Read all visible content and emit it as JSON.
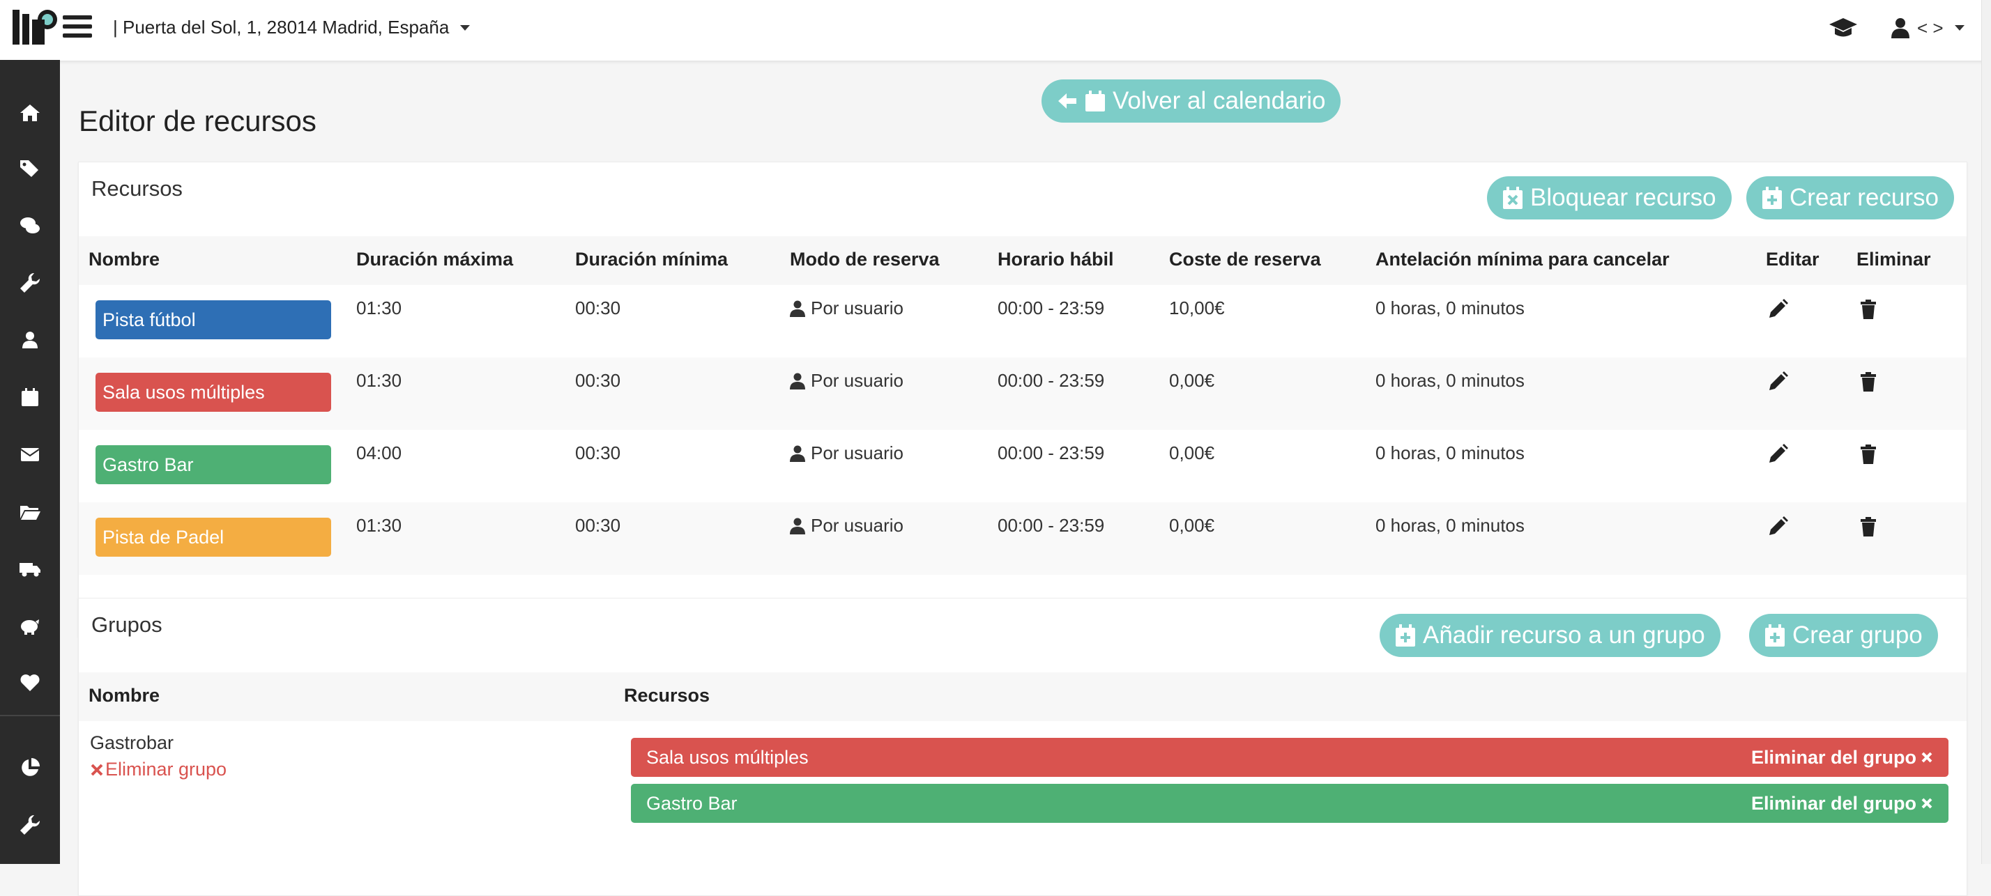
{
  "topbar": {
    "location": "| Puerta del Sol, 1, 28014 Madrid, España",
    "user_label": "< >"
  },
  "page": {
    "title": "Editor de recursos",
    "back_button": "Volver al calendario"
  },
  "resources": {
    "title": "Recursos",
    "block_button": "Bloquear recurso",
    "create_button": "Crear recurso",
    "headers": [
      "Nombre",
      "Duración máxima",
      "Duración mínima",
      "Modo de reserva",
      "Horario hábil",
      "Coste de reserva",
      "Antelación mínima para cancelar",
      "Editar",
      "Eliminar"
    ],
    "rows": [
      {
        "name": "Pista fútbol",
        "color": "#2e6fb5",
        "max": "01:30",
        "min": "00:30",
        "mode": "Por usuario",
        "hours": "00:00 - 23:59",
        "cost": "10,00€",
        "cancel": "0 horas, 0 minutos"
      },
      {
        "name": "Sala usos múltiples",
        "color": "#d9534f",
        "max": "01:30",
        "min": "00:30",
        "mode": "Por usuario",
        "hours": "00:00 - 23:59",
        "cost": "0,00€",
        "cancel": "0 horas, 0 minutos"
      },
      {
        "name": "Gastro Bar",
        "color": "#4eb074",
        "max": "04:00",
        "min": "00:30",
        "mode": "Por usuario",
        "hours": "00:00 - 23:59",
        "cost": "0,00€",
        "cancel": "0 horas, 0 minutos"
      },
      {
        "name": "Pista de Padel",
        "color": "#f4ad42",
        "max": "01:30",
        "min": "00:30",
        "mode": "Por usuario",
        "hours": "00:00 - 23:59",
        "cost": "0,00€",
        "cancel": "0 horas, 0 minutos"
      }
    ]
  },
  "groups": {
    "title": "Grupos",
    "add_button": "Añadir recurso a un grupo",
    "create_button": "Crear grupo",
    "headers": [
      "Nombre",
      "Recursos"
    ],
    "items": [
      {
        "name": "Gastrobar",
        "delete_label": "Eliminar grupo",
        "members": [
          {
            "name": "Sala usos múltiples",
            "color": "#d9534f",
            "remove_label": "Eliminar del grupo"
          },
          {
            "name": "Gastro Bar",
            "color": "#4eb074",
            "remove_label": "Eliminar del grupo"
          }
        ]
      }
    ]
  },
  "colors": {
    "accent_teal": "#7dcdc8",
    "sidebar_bg": "#2b2b2b",
    "danger": "#d9534f"
  },
  "icons": {
    "sidebar": [
      "home-icon",
      "tags-icon",
      "comments-icon",
      "wrench-icon",
      "users-icon",
      "calendar-icon",
      "envelope-icon",
      "folder-icon",
      "truck-icon",
      "piggy-bank-icon",
      "heart-icon",
      "pie-chart-icon",
      "tools-icon"
    ]
  }
}
